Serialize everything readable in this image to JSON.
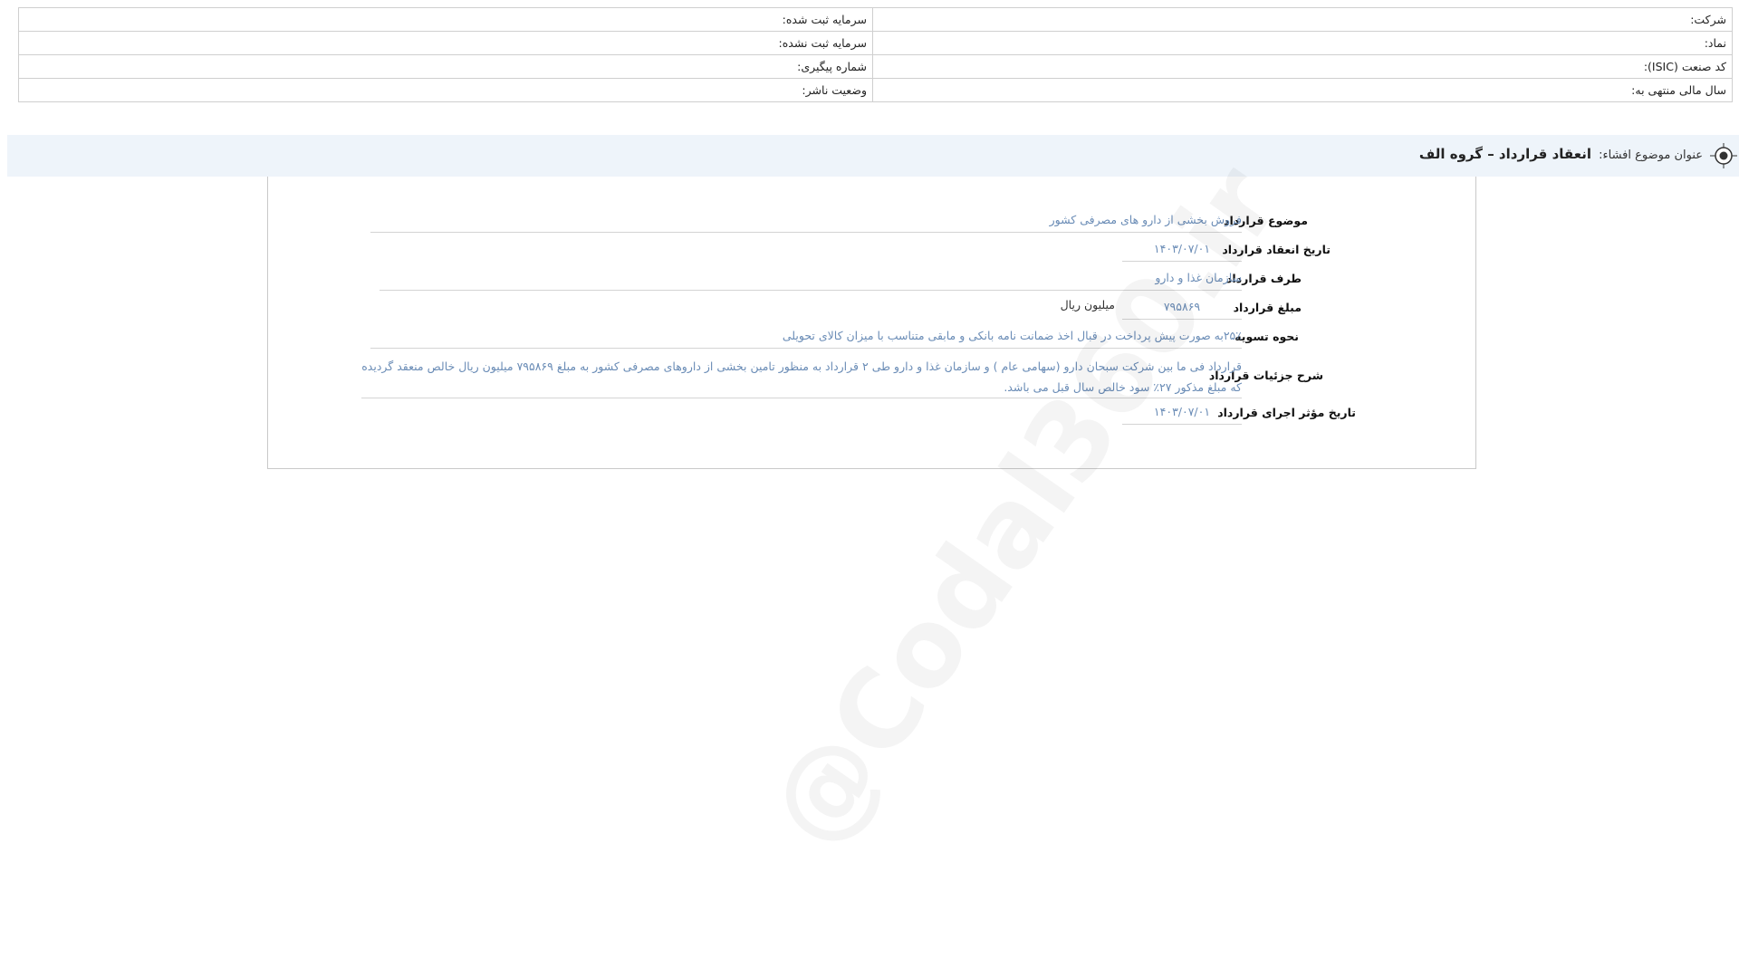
{
  "company_info": {
    "rows": [
      {
        "right_label": "شرکت:",
        "left_label": "سرمایه ثبت شده:"
      },
      {
        "right_label": "نماد:",
        "left_label": "سرمایه ثبت نشده:"
      },
      {
        "right_label": "کد صنعت (ISIC):",
        "left_label": "شماره پیگیری:"
      },
      {
        "right_label": "سال مالی منتهی به:",
        "left_label": "وضعیت ناشر:"
      }
    ]
  },
  "topic": {
    "icon": "target-icon",
    "prefix": "عنوان موضوع افشاء:",
    "value": "انعقاد قرارداد – گروه الف"
  },
  "details": {
    "subject_label": "موضوع قرارداد",
    "subject_value": "فروش بخشی از دارو های مصرفی کشور",
    "date_label": "تاریخ انعقاد قرارداد",
    "date_value": "۱۴۰۳/۰۷/۰۱",
    "party_label": "طرف قرارداد",
    "party_value": "سازمان غذا و دارو",
    "amount_label": "مبلغ قرارداد",
    "amount_value": "۷۹۵۸۶۹",
    "amount_unit": "میلیون ریال",
    "settlement_label": "نحوه تسویه",
    "settlement_value": "۲۵٪به صورت پیش پرداخت در قبال اخذ ضمانت نامه بانکی و مابقی متناسب با میزان کالای تحویلی",
    "description_label": "شرح جزئیات قرارداد",
    "description_value": "قرارداد فی ما بین شرکت سبحان دارو (سهامی عام ) و سازمان غذا و دارو طی ۲ قرارداد به منظور تامین بخشی از داروهای مصرفی کشور به مبلغ ۷۹۵۸۶۹ میلیون ریال خالص منعقد گردیده که مبلغ مذکور ۲۷٪ سود خالص سال قبل می باشد.",
    "effective_label": "تاریخ مؤثر اجرای قرارداد",
    "effective_value": "۱۴۰۳/۰۷/۰۱"
  },
  "watermark": "@Codal360.ir",
  "colors": {
    "value_text": "#6a8cb6",
    "topic_bar_bg": "#eef4fa",
    "border": "#cfcfcf"
  }
}
